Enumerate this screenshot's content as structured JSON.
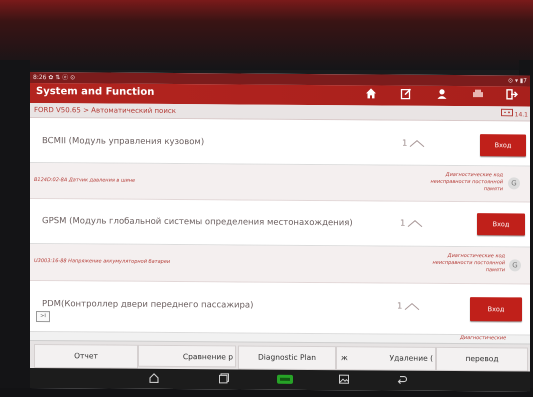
{
  "statusbar": {
    "time": "8:26",
    "left_icons": "✿ ⇅ ⓔ ⊙",
    "right": "⊙ ▾ ▮7"
  },
  "header": {
    "title": "System and Function"
  },
  "breadcrumb": {
    "text": "FORD V50.65 > Автоматический поиск",
    "right": "14.1"
  },
  "modules": [
    {
      "name": "BCMII (Модуль управления кузовом)",
      "count": "1",
      "enter": "Вход"
    },
    {
      "name": "GPSM (Модуль глобальной системы определения местонахождения)",
      "count": "1",
      "enter": "Вход"
    },
    {
      "name": "PDM(Контроллер двери переднего пассажира)",
      "count": "1",
      "enter": "Вход"
    }
  ],
  "dtcs": [
    {
      "code": "B124D:02-8A Датчик давления в шине",
      "type": "Диагностические код неисправности постоянной памяти"
    },
    {
      "code": "U3003:16-88 Напряжение аккумуляторной батареи",
      "type": "Диагностические код неисправности постоянной памяти"
    }
  ],
  "dtc_partial": "Диагностические",
  "small_button": ">I",
  "bottom": {
    "report": "Отчет",
    "compare": "Сравнение р",
    "plan": "Diagnostic Plan",
    "ж": "ж",
    "delete": "Удаление (",
    "translate": "перевод"
  },
  "colors": {
    "accent": "#b3241f",
    "button": "#c0201a"
  }
}
